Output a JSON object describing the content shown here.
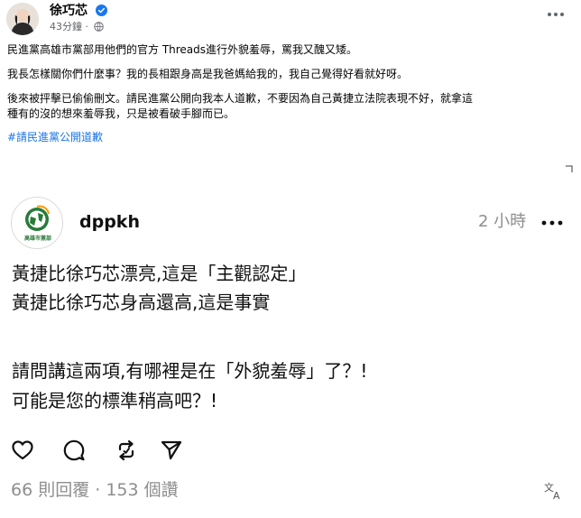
{
  "facebook_post": {
    "author": "徐巧芯",
    "time": "43分鐘 ·",
    "paragraphs": [
      "民進黨高雄市黨部用他們的官方 Threads進行外貌羞辱，罵我又醜又矮。",
      "我長怎樣關你們什麼事？我的長相跟身高是我爸媽給我的，我自己覺得好看就好呀。",
      "後來被抨擊已偷偷刪文。請民進黨公開向我本人道歉，不要因為自己黃捷立法院表現不好，就拿這\n種有的沒的想來羞辱我，只是被看破手腳而已。"
    ],
    "hashtag": "#請民進黨公開道歉"
  },
  "threads_post": {
    "username": "dppkh",
    "avatar_caption": "高雄市黨部",
    "time": "2 小時",
    "lines": [
      "黃捷比徐巧芯漂亮,這是「主觀認定」",
      "黃捷比徐巧芯身高還高,這是事實",
      "請問講這兩項,有哪裡是在「外貌羞辱」了？!",
      "可能是您的標準稍高吧？!"
    ],
    "stats": "66 則回覆 · 153 個讚"
  },
  "colors": {
    "link_blue": "#1b74e4",
    "verified_blue": "#1877f2",
    "muted_gray": "#65676b",
    "threads_gray": "#8e8e8e",
    "dpp_green": "#2a7a3a"
  },
  "icons": [
    "verified-icon",
    "globe-icon",
    "more-icon",
    "heart-icon",
    "comment-icon",
    "repost-icon",
    "share-icon",
    "translate-icon"
  ]
}
